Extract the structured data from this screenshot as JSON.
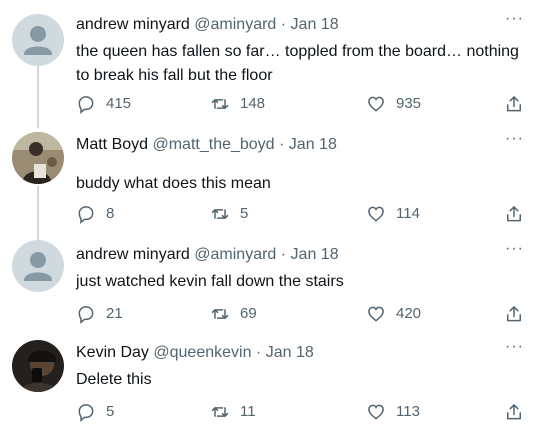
{
  "tweets": [
    {
      "name": "andrew minyard",
      "handle": "@aminyard",
      "date": "· Jan 18",
      "text": "the queen has fallen so far… toppled from the board… nothing to break his fall but the floor",
      "replies": "415",
      "retweets": "148",
      "likes": "935",
      "avatar": "default-avatar"
    },
    {
      "name": "Matt Boyd",
      "handle": "@matt_the_boyd",
      "date": "· Jan 18",
      "text": "buddy what does this mean",
      "replies": "8",
      "retweets": "5",
      "likes": "114",
      "avatar": "photo-avatar"
    },
    {
      "name": "andrew minyard",
      "handle": "@aminyard",
      "date": "· Jan 18",
      "text": "just watched kevin fall down the stairs",
      "replies": "21",
      "retweets": "69",
      "likes": "420",
      "avatar": "default-avatar"
    },
    {
      "name": "Kevin Day",
      "handle": "@queenkevin",
      "date": "· Jan 18",
      "text": "Delete this",
      "replies": "5",
      "retweets": "11",
      "likes": "113",
      "avatar": "photo-avatar"
    }
  ],
  "more_label": "···",
  "colors": {
    "text": "#0f1419",
    "secondary": "#536471",
    "thread_line": "#cfd9de",
    "avatar_bg": "#cfd9de",
    "avatar_fg": "#8899a6"
  }
}
